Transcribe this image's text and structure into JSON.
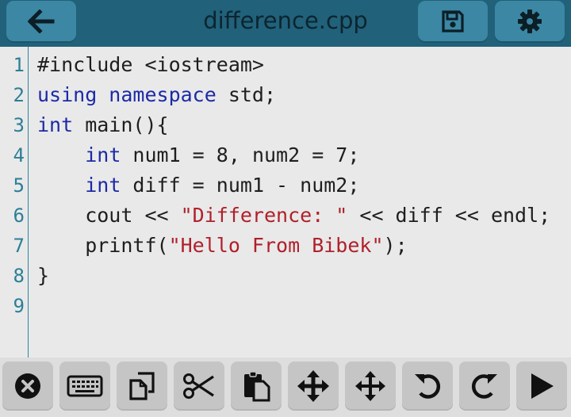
{
  "header": {
    "title": "difference.cpp",
    "back_icon": "arrow-left-icon",
    "save_icon": "floppy-disk-icon",
    "settings_icon": "gear-icon"
  },
  "editor": {
    "line_numbers": [
      "1",
      "2",
      "3",
      "4",
      "5",
      "6",
      "7",
      "8",
      "9"
    ],
    "lines": [
      [
        {
          "t": "#include <iostream>",
          "c": "plain"
        }
      ],
      [
        {
          "t": "using namespace",
          "c": "kw"
        },
        {
          "t": " std;",
          "c": "plain"
        }
      ],
      [
        {
          "t": "int",
          "c": "kw"
        },
        {
          "t": " main(){",
          "c": "plain"
        }
      ],
      [
        {
          "t": "    ",
          "c": "plain"
        },
        {
          "t": "int",
          "c": "kw"
        },
        {
          "t": " num1 = 8, num2 = 7;",
          "c": "plain"
        }
      ],
      [
        {
          "t": "    ",
          "c": "plain"
        },
        {
          "t": "int",
          "c": "kw"
        },
        {
          "t": " diff = num1 - num2;",
          "c": "plain"
        }
      ],
      [
        {
          "t": "    cout << ",
          "c": "plain"
        },
        {
          "t": "\"Difference: \"",
          "c": "str"
        },
        {
          "t": " << diff << endl;",
          "c": "plain"
        }
      ],
      [
        {
          "t": "    printf(",
          "c": "plain"
        },
        {
          "t": "\"Hello From Bibek\"",
          "c": "str"
        },
        {
          "t": ");",
          "c": "plain"
        }
      ],
      [
        {
          "t": "}",
          "c": "plain"
        }
      ],
      []
    ]
  },
  "toolbar": {
    "buttons": [
      {
        "name": "close-button",
        "icon": "close-circle-icon"
      },
      {
        "name": "keyboard-button",
        "icon": "keyboard-icon"
      },
      {
        "name": "copy-button",
        "icon": "copy-icon"
      },
      {
        "name": "cut-button",
        "icon": "scissors-icon"
      },
      {
        "name": "paste-button",
        "icon": "paste-icon"
      },
      {
        "name": "move-cursor-button",
        "icon": "move-arrows-icon"
      },
      {
        "name": "move-selection-button",
        "icon": "move-arrows-icon"
      },
      {
        "name": "undo-button",
        "icon": "undo-icon"
      },
      {
        "name": "redo-button",
        "icon": "redo-icon"
      },
      {
        "name": "run-button",
        "icon": "play-icon"
      }
    ]
  },
  "colors": {
    "header_bg": "#21617a",
    "header_button": "#3b87a4",
    "keyword": "#1c2aa6",
    "string": "#b0202a",
    "line_number": "#2b7f97"
  }
}
